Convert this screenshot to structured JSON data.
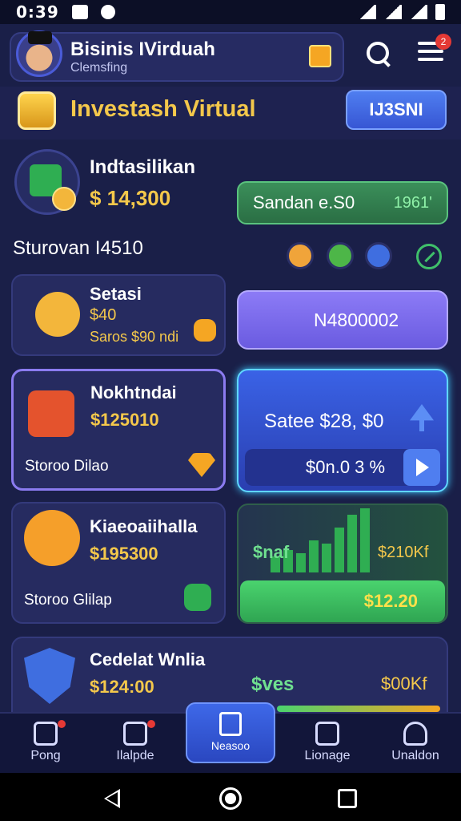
{
  "status_bar": {
    "time": "0:39"
  },
  "header": {
    "title": "Bisinis IVirduah",
    "subtitle": "Clemsfing",
    "notification_count": "2"
  },
  "section": {
    "title": "Investash Virtual",
    "tab_label": "IJ3SNI"
  },
  "balance": {
    "label": "Indtasilikan",
    "value": "$ 14,300",
    "standard_label": "Sandan e.S0",
    "standard_value": "1961'"
  },
  "subheading": "Sturovan I4510",
  "filter_chip_colors": [
    "#f0a43a",
    "#4db648",
    "#3f6ee0"
  ],
  "cards": [
    {
      "title": "Setasi",
      "value": "$40",
      "sub": "Saros $90 ndi",
      "action": "N4800002",
      "icon_color": "#f3b63b"
    },
    {
      "title": "Nokhtndai",
      "value": "$125010",
      "sub": "Storoo Dilao",
      "action": "Satee $28, $0",
      "action_sub": "$0n.0 3 %",
      "icon_color": "#e4532d"
    },
    {
      "title": "Kiaeoaiihalla",
      "value": "$195300",
      "sub": "Storoo Glilap",
      "chart_left": "$naf",
      "chart_right": "$210Kf",
      "action": "$12.20",
      "icon_color": "#f59f2a"
    },
    {
      "title": "Cedelat Wnlia",
      "value": "$124:00",
      "chart_left": "$ves",
      "chart_right": "$00Kf",
      "icon_color": "#3f6ee0"
    }
  ],
  "chart_bars": [
    0.25,
    0.35,
    0.3,
    0.5,
    0.45,
    0.7,
    0.9,
    1.0
  ],
  "nav": [
    {
      "label": "Pong",
      "badge": true
    },
    {
      "label": "Ilalpde",
      "badge": true
    },
    {
      "label": "Neasoo",
      "active": true
    },
    {
      "label": "Lionage"
    },
    {
      "label": "Unaldon"
    }
  ]
}
